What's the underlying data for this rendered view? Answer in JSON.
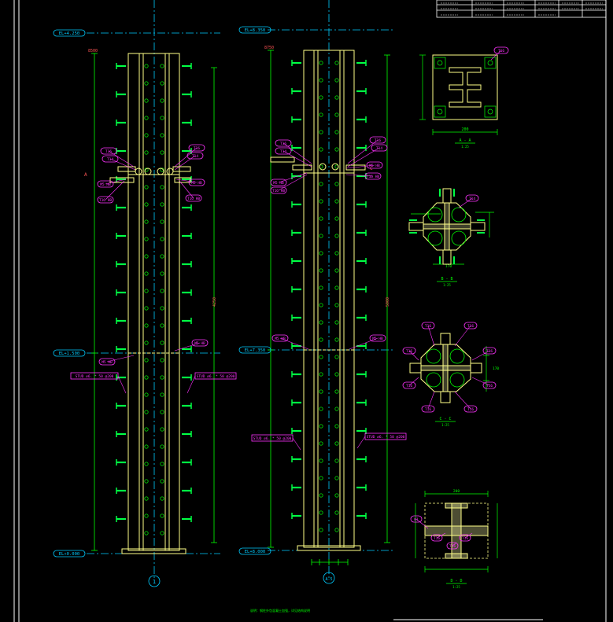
{
  "colors": {
    "background": "#000000",
    "frame": "#ffffff",
    "dimension": "#00ff00",
    "column": "#ffff88",
    "stud": "#00ff44",
    "bolt": "#00cc00",
    "centerline": "#00ccff",
    "callout": "#ff33ff",
    "weld": "#ffffaa"
  },
  "title_block": {
    "row1": [
      "",
      "",
      "",
      "",
      "",
      ""
    ],
    "row2": [
      "",
      "",
      "",
      "",
      "",
      "",
      "",
      ""
    ]
  },
  "left_column": {
    "top_level": "EL+4.250",
    "mid_level": "EL+1.500",
    "bottom_level": "EL+0.000",
    "section_cut_label": "A",
    "stud_note_left": "STUD ∅6. * 50 @200",
    "stud_note_right": "STUD ∅6. * 50 @200",
    "dim_top": "8500",
    "dim_total": "4250",
    "axis_bubble": "1",
    "callouts_top": [
      "T16",
      "T16",
      "T14",
      "T14",
      "M5 HB",
      "M5 HB",
      "T16 HB",
      "T16 HB"
    ],
    "callouts_mid": [
      "M5 HB",
      "M5 HB"
    ]
  },
  "right_column": {
    "top_level": "EL+8.350",
    "mid_level": "EL+7.350",
    "bottom_level": "EL+8.000",
    "section_cut_label": "C",
    "stud_note_left": "STUD ∅6. * 50 @200",
    "stud_note_right": "STUD ∅6. * 50 @200",
    "dim_top": "8750",
    "dim_total": "5000",
    "axis_bubble": "A-5",
    "callouts_top": [
      "T16",
      "T16",
      "T14",
      "T14",
      "M5 HB",
      "M5 HB",
      "T16 HB",
      "T16 HB"
    ],
    "callouts_mid": [
      "M5 HB",
      "M5 HB"
    ]
  },
  "sections": [
    {
      "label": "A - A",
      "scale": "1:25",
      "dim": "200"
    },
    {
      "label": "B - B",
      "scale": "1:25",
      "dim": "170"
    },
    {
      "label": "C - C",
      "scale": "1:25",
      "dim": "170"
    },
    {
      "label": "D - D",
      "scale": "1:25",
      "dim": "200"
    }
  ],
  "section_callouts": {
    "a": [
      "T16"
    ],
    "b": [
      "T14"
    ],
    "c": [
      "T16",
      "T16",
      "T16",
      "T16",
      "T16",
      "T16",
      "T16",
      "T16"
    ],
    "d": [
      "W1",
      "T16",
      "T16",
      "T16"
    ]
  },
  "footer_note": "说明：钢柱外包混凝土加强，详见结构说明"
}
